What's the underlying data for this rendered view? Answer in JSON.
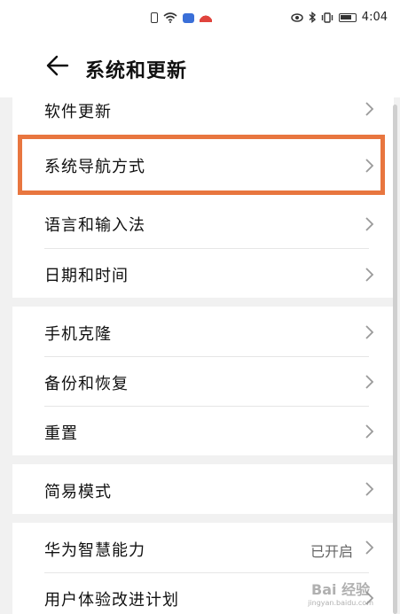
{
  "status_bar": {
    "time": "4:04"
  },
  "header": {
    "title": "系统和更新"
  },
  "groups": [
    {
      "items": [
        {
          "label": "软件更新",
          "value": ""
        },
        {
          "label": "系统导航方式",
          "value": ""
        },
        {
          "label": "语言和输入法",
          "value": ""
        },
        {
          "label": "日期和时间",
          "value": ""
        }
      ]
    },
    {
      "items": [
        {
          "label": "手机克隆",
          "value": ""
        },
        {
          "label": "备份和恢复",
          "value": ""
        },
        {
          "label": "重置",
          "value": ""
        }
      ]
    },
    {
      "items": [
        {
          "label": "简易模式",
          "value": ""
        }
      ]
    },
    {
      "items": [
        {
          "label": "华为智慧能力",
          "value": "已开启"
        },
        {
          "label": "用户体验改进计划",
          "value": ""
        }
      ]
    }
  ],
  "watermark": {
    "brand": "Bai 经验",
    "url": "jingyan.baidu.com"
  },
  "colors": {
    "highlight": "#e8763f",
    "background": "#f1f1f1"
  }
}
